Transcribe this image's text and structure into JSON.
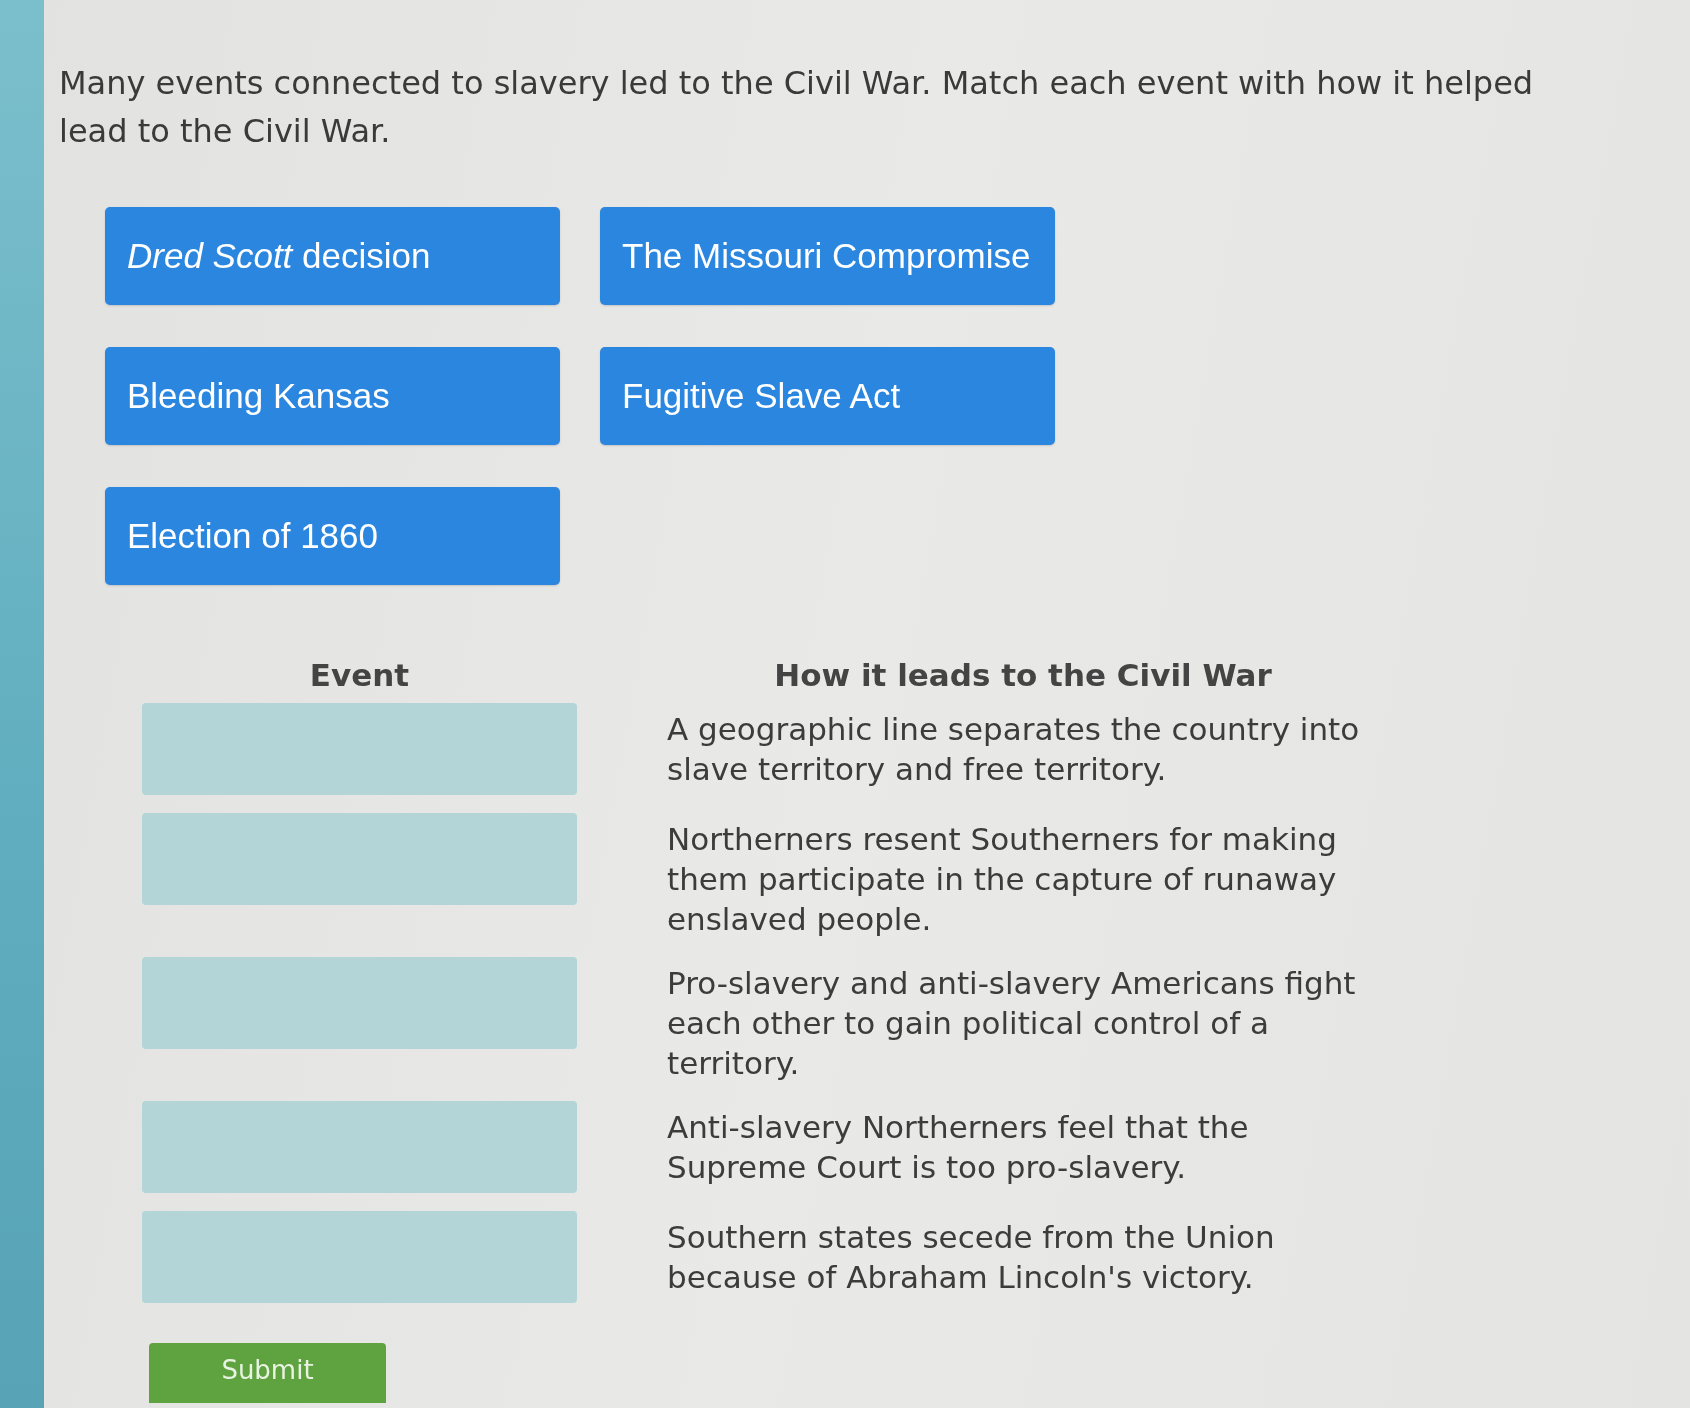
{
  "prompt": "Many events connected to slavery led to the Civil War. Match each event with how it helped lead to the Civil War.",
  "event_tiles": [
    "*Dred Scott* decision",
    "The Missouri Compromise",
    "Bleeding Kansas",
    "Fugitive Slave Act",
    "Election of 1860"
  ],
  "match_table": {
    "columns": [
      "Event",
      "How it leads to the Civil War"
    ],
    "rows": [
      {
        "description": "A geographic line separates the country into slave territory and free territory."
      },
      {
        "description": "Northerners resent Southerners for making them participate in the capture of runaway enslaved people."
      },
      {
        "description": "Pro-slavery and anti-slavery Americans fight each other to gain political control of a territory."
      },
      {
        "description": "Anti-slavery Northerners feel that the Supreme Court is too pro-slavery."
      },
      {
        "description": "Southern states secede from the Union because of Abraham Lincoln's victory."
      }
    ]
  },
  "submit_button": "Submit"
}
